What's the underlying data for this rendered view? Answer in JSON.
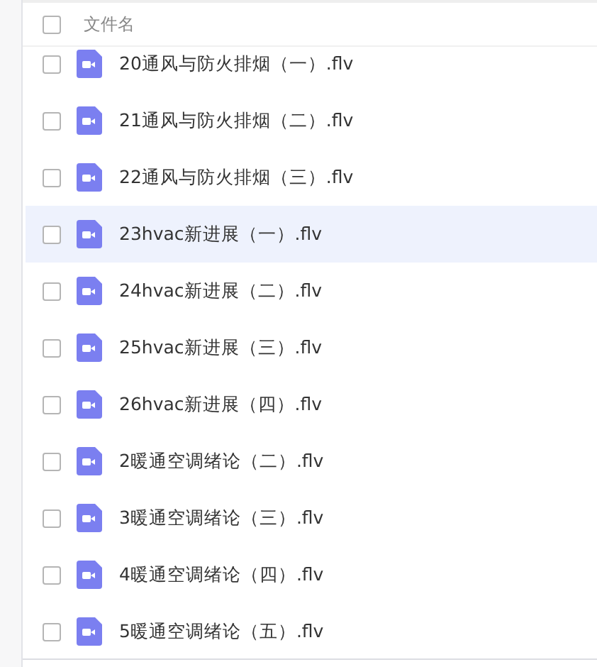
{
  "header": {
    "checked": false,
    "label": "文件名"
  },
  "files": [
    {
      "name": "20通风与防火排烟（一）.flv",
      "checked": false,
      "highlighted": false
    },
    {
      "name": "21通风与防火排烟（二）.flv",
      "checked": false,
      "highlighted": false
    },
    {
      "name": "22通风与防火排烟（三）.flv",
      "checked": false,
      "highlighted": false
    },
    {
      "name": "23hvac新进展（一）.flv",
      "checked": false,
      "highlighted": true
    },
    {
      "name": "24hvac新进展（二）.flv",
      "checked": false,
      "highlighted": false
    },
    {
      "name": "25hvac新进展（三）.flv",
      "checked": false,
      "highlighted": false
    },
    {
      "name": "26hvac新进展（四）.flv",
      "checked": false,
      "highlighted": false
    },
    {
      "name": "2暖通空调绪论（二）.flv",
      "checked": false,
      "highlighted": false
    },
    {
      "name": "3暖通空调绪论（三）.flv",
      "checked": false,
      "highlighted": false
    },
    {
      "name": "4暖通空调绪论（四）.flv",
      "checked": false,
      "highlighted": false
    },
    {
      "name": "5暖通空调绪论（五）.flv",
      "checked": false,
      "highlighted": false
    }
  ]
}
